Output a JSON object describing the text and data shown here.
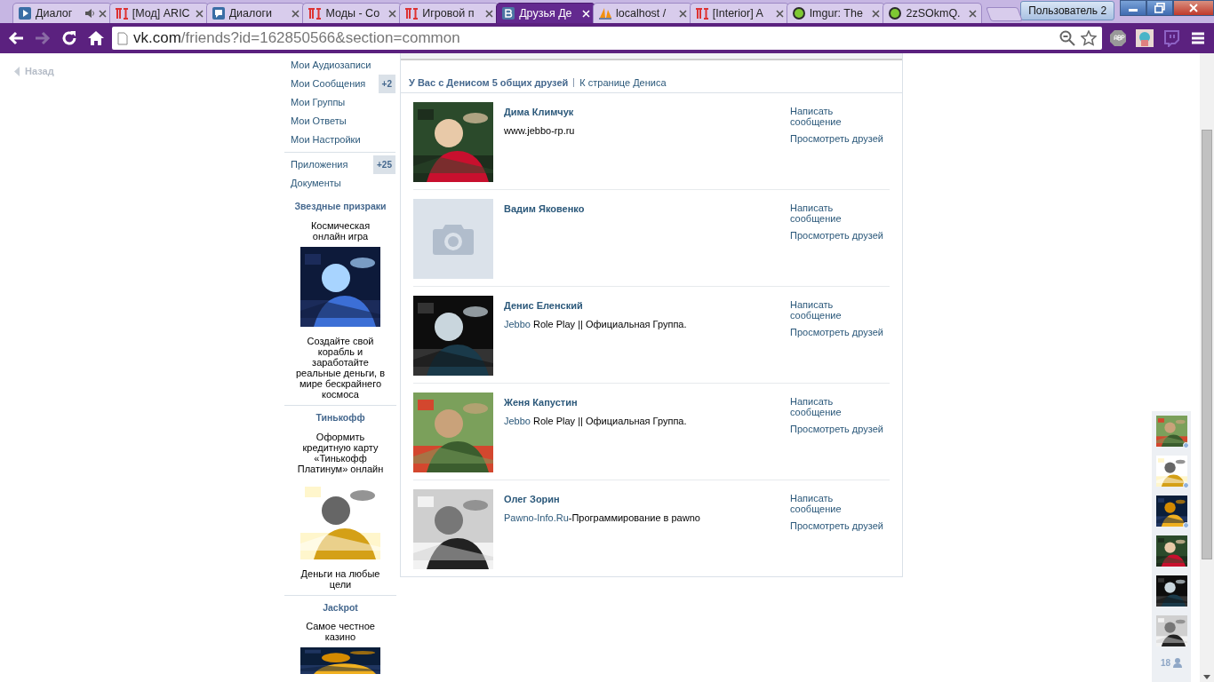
{
  "browser": {
    "tabs": [
      {
        "title": "Диалог",
        "audio": true,
        "selected": false
      },
      {
        "title": "[Мод] ARIC",
        "audio": false,
        "selected": false
      },
      {
        "title": "Диалоги",
        "audio": false,
        "selected": false
      },
      {
        "title": "Моды - Co",
        "audio": false,
        "selected": false
      },
      {
        "title": "Игровой п",
        "audio": false,
        "selected": false
      },
      {
        "title": "Друзья Де",
        "audio": false,
        "selected": true
      },
      {
        "title": "localhost /",
        "audio": false,
        "selected": false
      },
      {
        "title": "[Interior] A",
        "audio": false,
        "selected": false
      },
      {
        "title": "Imgur: The",
        "audio": false,
        "selected": false
      },
      {
        "title": "2zSOkmQ.",
        "audio": false,
        "selected": false
      }
    ],
    "profile_button": "Пользователь 2",
    "url": {
      "host": "vk.com",
      "path": "/friends?id=162850566&section=common"
    },
    "forward_disabled": true
  },
  "back_link": "Назад",
  "menu": [
    {
      "label": "Мои Аудиозаписи"
    },
    {
      "label": "Мои Сообщения",
      "counter": "+2"
    },
    {
      "label": "Мои Группы"
    },
    {
      "label": "Мои Ответы"
    },
    {
      "label": "Мои Настройки",
      "divider_after": true
    },
    {
      "label": "Приложения",
      "counter": "+25"
    },
    {
      "label": "Документы"
    }
  ],
  "ads": [
    {
      "title": "Звездные призраки",
      "text_above": "Космическая онлайн игра",
      "text_below": "Создайте свой корабль и заработайте реальные деньги, в мире бескрайнего космоса"
    },
    {
      "title": "Тинькофф",
      "text_above": "Оформить кредитную карту «Тинькофф Платинум» онлайн",
      "text_below": "Деньги на любые цели"
    },
    {
      "title": "Jackpot",
      "text_above": "Самое честное казино"
    }
  ],
  "summary": {
    "title": "У Вас с Денисом 5 общих друзей",
    "link": "К странице Дениса"
  },
  "friends": [
    {
      "name": "Дима Климчук",
      "kind": "picture",
      "status": {
        "text": "www.jebbo-rp.ru"
      },
      "actions": [
        "Написать сообщение",
        "Просмотреть друзей"
      ]
    },
    {
      "name": "Вадим Яковенко",
      "kind": "placeholder",
      "actions": [
        "Написать сообщение",
        "Просмотреть друзей"
      ]
    },
    {
      "name": "Денис Еленский",
      "kind": "picture",
      "status": {
        "link": "Jebbo",
        "text": " Role Play || Официальная Группа."
      },
      "actions": [
        "Написать сообщение",
        "Просмотреть друзей"
      ]
    },
    {
      "name": "Женя Капустин",
      "kind": "picture",
      "status": {
        "link": "Jebbo",
        "text": " Role Play || Официальная Группа."
      },
      "actions": [
        "Написать сообщение",
        "Просмотреть друзей"
      ]
    },
    {
      "name": "Олег Зорин",
      "kind": "picture",
      "status": {
        "link": "Pawno-Info.Ru",
        "text": "-Программирование в pawno"
      },
      "actions": [
        "Написать сообщение",
        "Просмотреть друзей"
      ]
    }
  ],
  "chat_sidebar": {
    "contacts": [
      {
        "online": true
      },
      {
        "online": true
      },
      {
        "online": true
      },
      {
        "online": false
      },
      {
        "online": false
      },
      {
        "online": false
      }
    ],
    "count": "18"
  }
}
